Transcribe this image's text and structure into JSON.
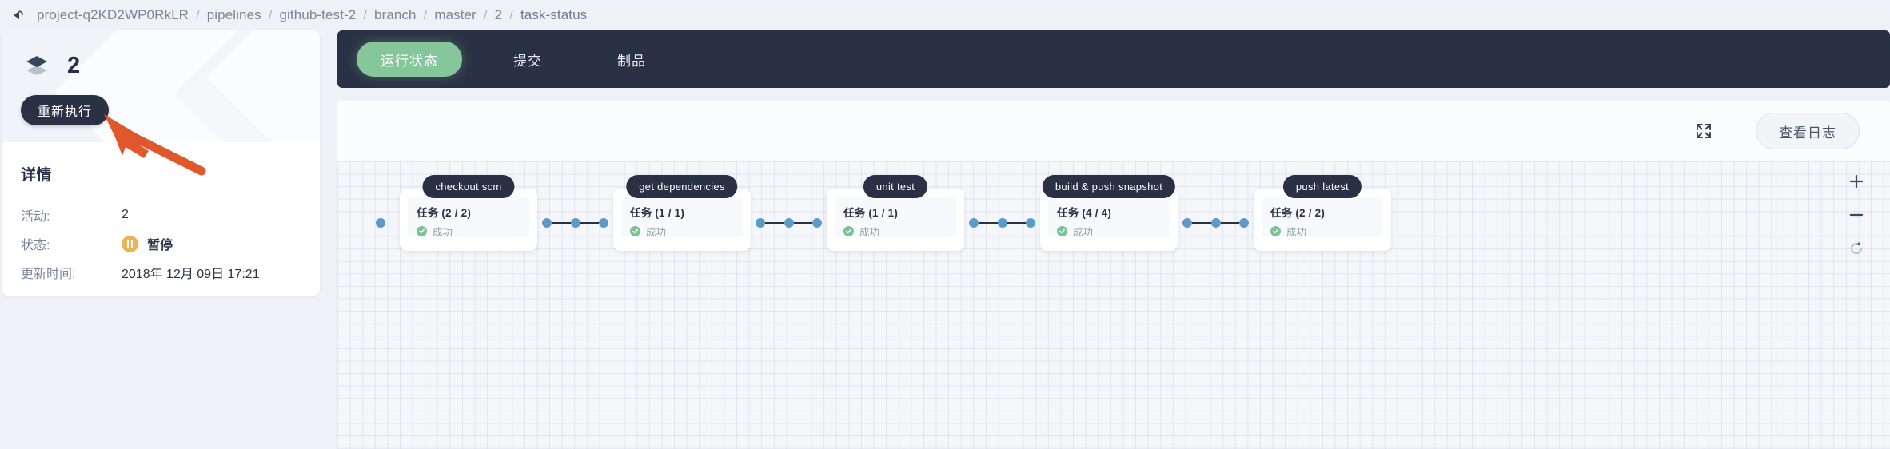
{
  "breadcrumb": {
    "back_icon": "back-arrow-icon",
    "items": [
      "project-q2KD2WP0RkLR",
      "pipelines",
      "github-test-2",
      "branch",
      "master",
      "2",
      "task-status"
    ],
    "separator": "/"
  },
  "left_panel": {
    "layers_icon": "layers-icon",
    "pipeline_number": "2",
    "rerun_label": "重新执行",
    "details_title": "详情",
    "rows": [
      {
        "label": "活动:",
        "value": "2",
        "icon": null
      },
      {
        "label": "状态:",
        "value": "暂停",
        "icon": "pause-icon"
      },
      {
        "label": "更新时间:",
        "value": "2018年 12月 09日 17:21",
        "icon": null
      }
    ]
  },
  "annotation": {
    "arrow_color": "#e0572c",
    "target": "重新执行"
  },
  "tabs": [
    {
      "label": "运行状态",
      "active": true
    },
    {
      "label": "提交",
      "active": false
    },
    {
      "label": "制品",
      "active": false
    }
  ],
  "toolbar": {
    "expand_icon": "expand-icon",
    "view_log_label": "查看日志"
  },
  "zoom_controls": [
    {
      "name": "zoom-in-button",
      "glyph": "+"
    },
    {
      "name": "zoom-out-button",
      "glyph": "−"
    },
    {
      "name": "reset-view-button",
      "glyph": "reset-icon"
    }
  ],
  "graph": {
    "nodes": [
      {
        "label": "checkout scm",
        "task": "任务 (2 / 2)",
        "status": "成功",
        "status_icon": "success-check-icon"
      },
      {
        "label": "get dependencies",
        "task": "任务 (1 / 1)",
        "status": "成功",
        "status_icon": "success-check-icon"
      },
      {
        "label": "unit test",
        "task": "任务 (1 / 1)",
        "status": "成功",
        "status_icon": "success-check-icon"
      },
      {
        "label": "build & push snapshot",
        "task": "任务 (4 / 4)",
        "status": "成功",
        "status_icon": "success-check-icon"
      },
      {
        "label": "push latest",
        "task": "任务 (2 / 2)",
        "status": "成功",
        "status_icon": "success-check-icon"
      }
    ]
  },
  "colors": {
    "accent_green": "#85c69a",
    "dark_navy": "#2b3145",
    "status_amber": "#e9b356",
    "connector_blue": "#5e9ac9",
    "annotation_orange": "#e0572c"
  }
}
